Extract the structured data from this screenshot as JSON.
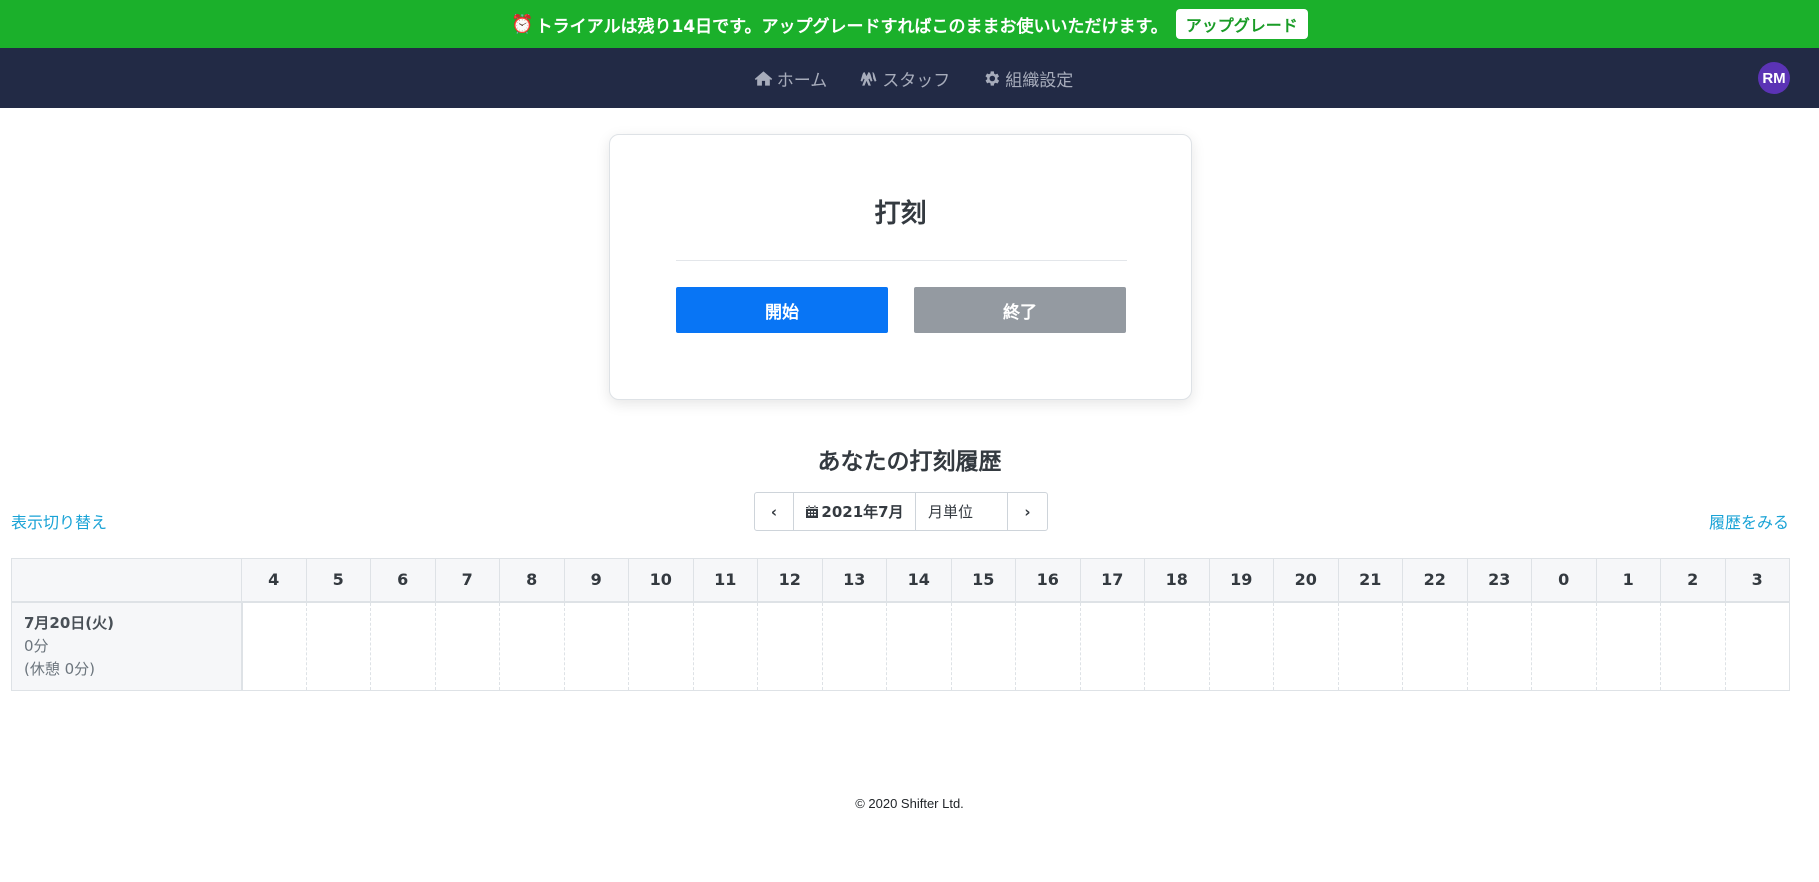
{
  "banner": {
    "alarm_icon": "⏰",
    "message": "トライアルは残り14日です。アップグレードすればこのままお使いいただけます。",
    "upgrade_label": "アップグレード",
    "background": "#1bb02b"
  },
  "nav": {
    "items": [
      {
        "label": "ホーム",
        "icon": "home-icon"
      },
      {
        "label": "スタッフ",
        "icon": "staff-icon"
      },
      {
        "label": "組織設定",
        "icon": "gear-icon"
      }
    ],
    "avatar_initials": "RM",
    "background": "#222a45"
  },
  "punch": {
    "title": "打刻",
    "start_label": "開始",
    "end_label": "終了",
    "start_color": "#0875f5",
    "end_color": "#949aa1"
  },
  "history": {
    "title": "あなたの打刻履歴",
    "toggle_label": "表示切り替え",
    "view_history_label": "履歴をみる",
    "month_label": "2021年7月",
    "unit_label": "月単位",
    "hours": [
      "4",
      "5",
      "6",
      "7",
      "8",
      "9",
      "10",
      "11",
      "12",
      "13",
      "14",
      "15",
      "16",
      "17",
      "18",
      "19",
      "20",
      "21",
      "22",
      "23",
      "0",
      "1",
      "2",
      "3"
    ],
    "rows": [
      {
        "date": "7月20日(火)",
        "duration": "0分",
        "break": "(休憩 0分)"
      }
    ]
  },
  "footer": {
    "copyright": "© 2020 Shifter Ltd."
  }
}
